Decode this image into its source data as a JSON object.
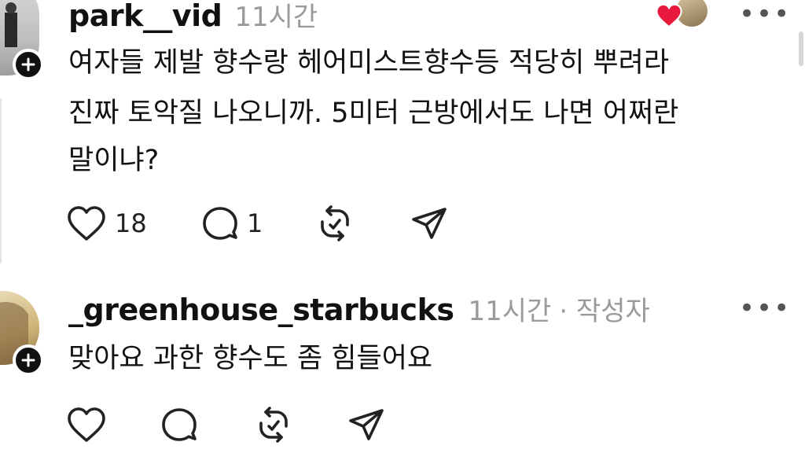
{
  "comments": [
    {
      "username": "park__vid",
      "time": "11시간",
      "text_lines": [
        "여자들 제발 향수랑 헤어미스트향수등 적당히 뿌려라",
        "진짜 토악질 나오니까. 5미터 근방에서도 나면 어쩌란",
        "말이냐?"
      ],
      "likes": "18",
      "replies": "1",
      "liked_by_author": true
    },
    {
      "username": "_greenhouse_starbucks",
      "time": "11시간",
      "author_label": "· 작성자",
      "text_lines": [
        "맞아요 과한 향수도 좀 힘들어요"
      ]
    }
  ],
  "more_glyph": "•••",
  "colors": {
    "heart": "#e8193c",
    "meta": "#9a9a9a",
    "text": "#111111"
  },
  "icons": [
    "heart-icon",
    "comment-icon",
    "repost-icon",
    "share-icon",
    "plus-icon",
    "more-icon"
  ]
}
